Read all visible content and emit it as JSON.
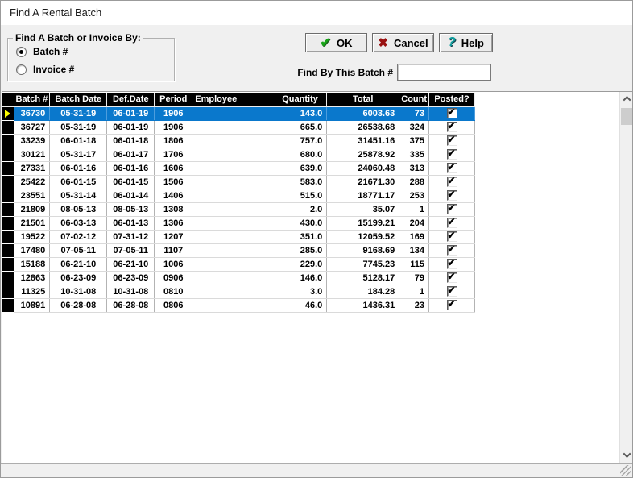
{
  "window": {
    "title": "Find A Rental Batch"
  },
  "buttons": {
    "ok": "OK",
    "cancel": "Cancel",
    "help": "Help"
  },
  "finder": {
    "group_label": "Find A Batch or Invoice By:",
    "options": [
      {
        "label": "Batch #",
        "selected": true
      },
      {
        "label": "Invoice #",
        "selected": false
      }
    ],
    "find_by_label": "Find By This Batch #",
    "find_by_value": ""
  },
  "grid": {
    "columns": [
      "",
      "Batch #",
      "Batch Date",
      "Def.Date",
      "Period",
      "Employee",
      "Quantity",
      "Total",
      "Count",
      "Posted?"
    ],
    "selected_index": 0,
    "rows": [
      {
        "batch": "36730",
        "batch_date": "05-31-19",
        "def_date": "06-01-19",
        "period": "1906",
        "employee": "",
        "quantity": "143.0",
        "total": "6003.63",
        "count": "73",
        "posted": true
      },
      {
        "batch": "36727",
        "batch_date": "05-31-19",
        "def_date": "06-01-19",
        "period": "1906",
        "employee": "",
        "quantity": "665.0",
        "total": "26538.68",
        "count": "324",
        "posted": true
      },
      {
        "batch": "33239",
        "batch_date": "06-01-18",
        "def_date": "06-01-18",
        "period": "1806",
        "employee": "",
        "quantity": "757.0",
        "total": "31451.16",
        "count": "375",
        "posted": true
      },
      {
        "batch": "30121",
        "batch_date": "05-31-17",
        "def_date": "06-01-17",
        "period": "1706",
        "employee": "",
        "quantity": "680.0",
        "total": "25878.92",
        "count": "335",
        "posted": true
      },
      {
        "batch": "27331",
        "batch_date": "06-01-16",
        "def_date": "06-01-16",
        "period": "1606",
        "employee": "",
        "quantity": "639.0",
        "total": "24060.48",
        "count": "313",
        "posted": true
      },
      {
        "batch": "25422",
        "batch_date": "06-01-15",
        "def_date": "06-01-15",
        "period": "1506",
        "employee": "",
        "quantity": "583.0",
        "total": "21671.30",
        "count": "288",
        "posted": true
      },
      {
        "batch": "23551",
        "batch_date": "05-31-14",
        "def_date": "06-01-14",
        "period": "1406",
        "employee": "",
        "quantity": "515.0",
        "total": "18771.17",
        "count": "253",
        "posted": true
      },
      {
        "batch": "21809",
        "batch_date": "08-05-13",
        "def_date": "08-05-13",
        "period": "1308",
        "employee": "",
        "quantity": "2.0",
        "total": "35.07",
        "count": "1",
        "posted": true
      },
      {
        "batch": "21501",
        "batch_date": "06-03-13",
        "def_date": "06-01-13",
        "period": "1306",
        "employee": "",
        "quantity": "430.0",
        "total": "15199.21",
        "count": "204",
        "posted": true
      },
      {
        "batch": "19522",
        "batch_date": "07-02-12",
        "def_date": "07-31-12",
        "period": "1207",
        "employee": "",
        "quantity": "351.0",
        "total": "12059.52",
        "count": "169",
        "posted": true
      },
      {
        "batch": "17480",
        "batch_date": "07-05-11",
        "def_date": "07-05-11",
        "period": "1107",
        "employee": "",
        "quantity": "285.0",
        "total": "9168.69",
        "count": "134",
        "posted": true
      },
      {
        "batch": "15188",
        "batch_date": "06-21-10",
        "def_date": "06-21-10",
        "period": "1006",
        "employee": "",
        "quantity": "229.0",
        "total": "7745.23",
        "count": "115",
        "posted": true
      },
      {
        "batch": "12863",
        "batch_date": "06-23-09",
        "def_date": "06-23-09",
        "period": "0906",
        "employee": "",
        "quantity": "146.0",
        "total": "5128.17",
        "count": "79",
        "posted": true
      },
      {
        "batch": "11325",
        "batch_date": "10-31-08",
        "def_date": "10-31-08",
        "period": "0810",
        "employee": "",
        "quantity": "3.0",
        "total": "184.28",
        "count": "1",
        "posted": true
      },
      {
        "batch": "10891",
        "batch_date": "06-28-08",
        "def_date": "06-28-08",
        "period": "0806",
        "employee": "",
        "quantity": "46.0",
        "total": "1436.31",
        "count": "23",
        "posted": true
      }
    ]
  },
  "icons": {
    "ok": "check-icon",
    "cancel": "x-icon",
    "help": "question-icon",
    "ok_glyph": "✔",
    "cancel_glyph": "✖",
    "help_glyph": "?",
    "check_glyph": "✔"
  },
  "colors": {
    "selection_blue": "#0a78cc",
    "header_bg": "#000000",
    "marker_yellow": "#ffff00",
    "ok_green": "#17a317",
    "cancel_red": "#991111",
    "help_teal": "#0e9e9e"
  }
}
